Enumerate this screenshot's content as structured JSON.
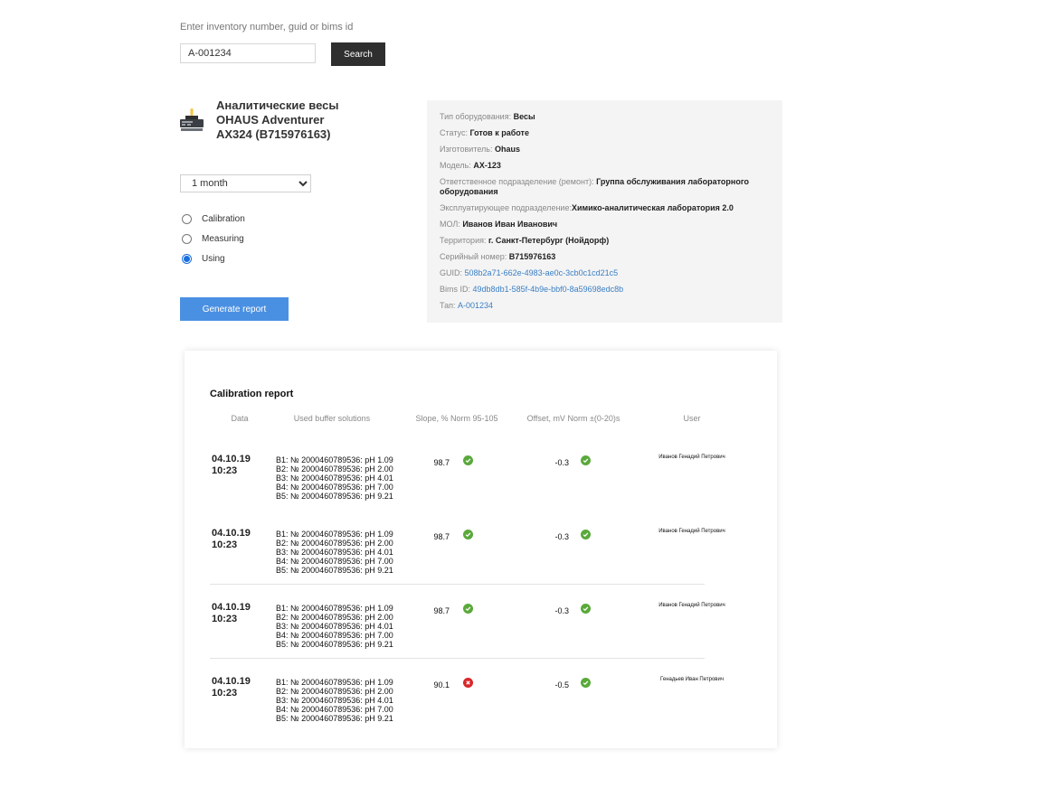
{
  "search": {
    "label": "Enter inventory number, guid or bims id",
    "value": "A-001234",
    "button": "Search"
  },
  "equipment": {
    "icon": "scale-icon",
    "title_lines": [
      "Аналитические весы",
      "OHAUS Adventurer",
      "AX324 (B715976163)"
    ]
  },
  "period": {
    "selected": "1 month",
    "options": [
      "1 month"
    ]
  },
  "report_types": [
    {
      "label": "Calibration",
      "checked": false
    },
    {
      "label": "Measuring",
      "checked": false
    },
    {
      "label": "Using",
      "checked": true
    }
  ],
  "generate_button": "Generate report",
  "info": [
    {
      "key": "Тип оборудования:",
      "value": "Весы",
      "link": false
    },
    {
      "key": "Статус:",
      "value": "Готов к работе",
      "link": false
    },
    {
      "key": "Изготовитель:",
      "value": "Ohaus",
      "link": false
    },
    {
      "key": "Модель:",
      "value": "AX-123",
      "link": false
    },
    {
      "key": "Ответственное подразделение (ремонт):",
      "value": "Группа обслуживания лабораторного оборудования",
      "link": false
    },
    {
      "key": "Эксплуатирующее подразделение:",
      "value": "Химико-аналитическая лаборатория 2.0",
      "link": false
    },
    {
      "key": "МОЛ:",
      "value": "Иванов Иван Иванович",
      "link": false
    },
    {
      "key": "Территория:",
      "value": "г. Санкт-Петербург (Нойдорф)",
      "link": false
    },
    {
      "key": "Серийный номер:",
      "value": "B715976163",
      "link": false
    },
    {
      "key": "GUID:",
      "value": "508b2a71-662e-4983-ae0c-3cb0c1cd21c5",
      "link": true
    },
    {
      "key": "Bims ID:",
      "value": "49db8db1-585f-4b9e-bbf0-8a59698edc8b",
      "link": true
    },
    {
      "key": "Тап:",
      "value": "A-001234",
      "link": true
    }
  ],
  "report": {
    "title": "Calibration report",
    "headers": [
      "Data",
      "Used buffer solutions",
      "Slope, % Norm 95-105",
      "Offset, mV Norm ±(0-20)s",
      "User"
    ],
    "rows": [
      {
        "date": "04.10.19",
        "time": "10:23",
        "buffers": [
          "B1: № 2000460789536: pH 1.09",
          "B2: № 2000460789536: pH 2.00",
          "B3: № 2000460789536: pH 4.01",
          "B4: № 2000460789536: pH 7.00",
          "B5: № 2000460789536: pH 9.21"
        ],
        "slope": "98.7",
        "slope_ok": true,
        "offset": "-0.3",
        "offset_ok": true,
        "user": "Иванов Генадий Петрович"
      },
      {
        "date": "04.10.19",
        "time": "10:23",
        "buffers": [
          "B1: № 2000460789536: pH 1.09",
          "B2: № 2000460789536: pH 2.00",
          "B3: № 2000460789536: pH 4.01",
          "B4: № 2000460789536: pH 7.00",
          "B5: № 2000460789536: pH 9.21"
        ],
        "slope": "98.7",
        "slope_ok": true,
        "offset": "-0.3",
        "offset_ok": true,
        "user": "Иванов Генадий Петрович"
      },
      {
        "date": "04.10.19",
        "time": "10:23",
        "buffers": [
          "B1: № 2000460789536: pH 1.09",
          "B2: № 2000460789536: pH 2.00",
          "B3: № 2000460789536: pH 4.01",
          "B4: № 2000460789536: pH 7.00",
          "B5: № 2000460789536: pH 9.21"
        ],
        "slope": "98.7",
        "slope_ok": true,
        "offset": "-0.3",
        "offset_ok": true,
        "user": "Иванов Генадий Петрович"
      },
      {
        "date": "04.10.19",
        "time": "10:23",
        "buffers": [
          "B1: № 2000460789536: pH 1.09",
          "B2: № 2000460789536: pH 2.00",
          "B3: № 2000460789536: pH 4.01",
          "B4: № 2000460789536: pH 7.00",
          "B5: № 2000460789536: pH 9.21"
        ],
        "slope": "90.1",
        "slope_ok": false,
        "offset": "-0.5",
        "offset_ok": true,
        "user": "Генадьев Иван Петрович"
      }
    ]
  },
  "colors": {
    "ok": "#5aa93b",
    "bad": "#d9262a",
    "primary": "#4a90e2",
    "link": "#3a7fc4"
  }
}
